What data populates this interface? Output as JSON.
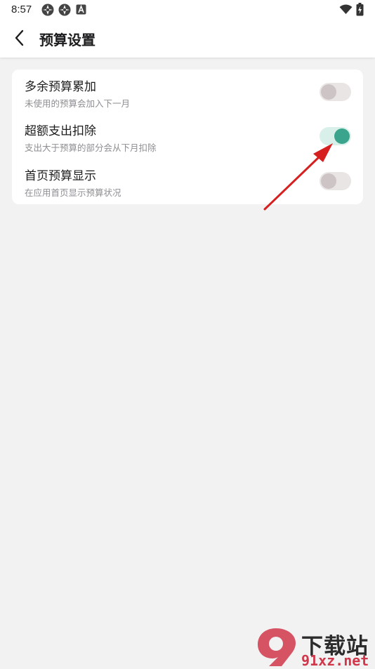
{
  "status_bar": {
    "time": "8:57",
    "icons": [
      "app-notification-icon",
      "app-notification-icon",
      "accessibility-a-icon",
      "wifi-icon",
      "battery-charging-icon"
    ]
  },
  "header": {
    "back_icon": "chevron-left-icon",
    "title": "预算设置"
  },
  "settings": [
    {
      "title": "多余预算累加",
      "description": "未使用的预算会加入下一月",
      "enabled": false
    },
    {
      "title": "超额支出扣除",
      "description": "支出大于预算的部分会从下月扣除",
      "enabled": true
    },
    {
      "title": "首页预算显示",
      "description": "在应用首页显示预算状况",
      "enabled": false
    }
  ],
  "colors": {
    "toggle_on_knob": "#3aa58c",
    "toggle_on_track": "#d9f0ea",
    "toggle_off_knob": "#cdc4c6",
    "toggle_off_track": "#e9e5e5",
    "annotation_arrow": "#d62020",
    "watermark_red": "#d1374a"
  },
  "watermark": {
    "line1": "下载站",
    "line2": "91xz.net",
    "logo_mark": "9"
  }
}
